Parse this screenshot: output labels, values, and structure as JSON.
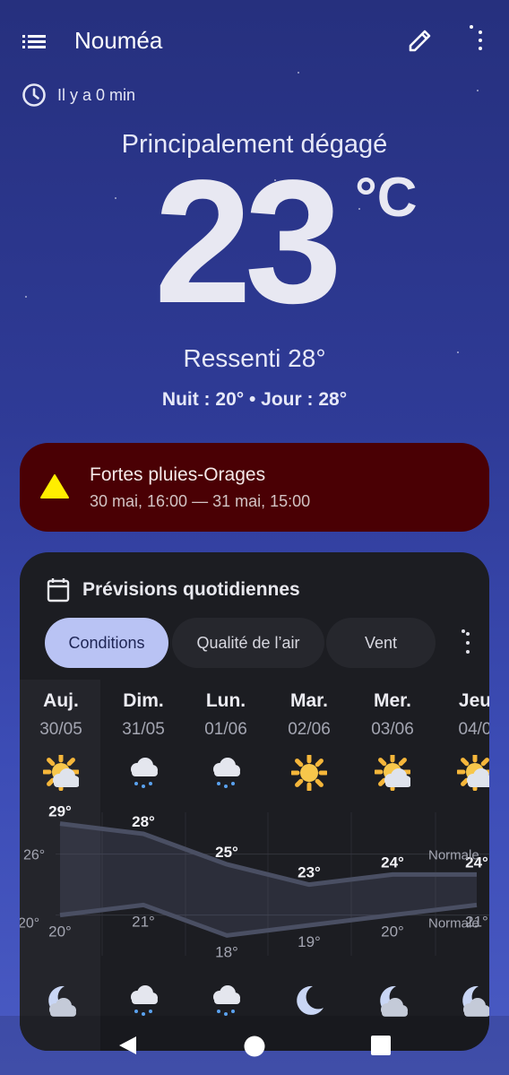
{
  "header": {
    "city": "Nouméa"
  },
  "updated": {
    "text": "Il y a 0 min"
  },
  "current": {
    "condition": "Principalement dégagé",
    "temperature": "23",
    "unit": "°C",
    "feels_like": "Ressenti 28°",
    "night_day": "Nuit : 20° • Jour : 28°"
  },
  "alert": {
    "title": "Fortes pluies-Orages",
    "period": "30 mai, 16:00 — 31 mai, 15:00",
    "background": "#4a0004",
    "icon_color": "#ffee00"
  },
  "forecast": {
    "title": "Prévisions quotidiennes",
    "tabs": [
      {
        "label": "Conditions",
        "active": true
      },
      {
        "label": "Qualité de l’air",
        "active": false
      },
      {
        "label": "Vent",
        "active": false
      }
    ],
    "days": [
      {
        "name": "Auj.",
        "date": "30/05",
        "day_icon": "sun-cloud-icon",
        "night_icon": "moon-cloud-icon",
        "high": 29,
        "low": 20,
        "high_label": "29°",
        "low_label": "20°"
      },
      {
        "name": "Dim.",
        "date": "31/05",
        "day_icon": "rain-icon",
        "night_icon": "rain-icon",
        "high": 28,
        "low": 21,
        "high_label": "28°",
        "low_label": "21°"
      },
      {
        "name": "Lun.",
        "date": "01/06",
        "day_icon": "rain-icon",
        "night_icon": "rain-icon",
        "high": 25,
        "low": 18,
        "high_label": "25°",
        "low_label": "18°"
      },
      {
        "name": "Mar.",
        "date": "02/06",
        "day_icon": "sun-icon",
        "night_icon": "moon-icon",
        "high": 23,
        "low": 19,
        "high_label": "23°",
        "low_label": "19°"
      },
      {
        "name": "Mer.",
        "date": "03/06",
        "day_icon": "sun-cloud-icon",
        "night_icon": "moon-cloud-icon",
        "high": 24,
        "low": 20,
        "high_label": "24°",
        "low_label": "20°"
      },
      {
        "name": "Jeu",
        "date": "04/0",
        "day_icon": "sun-cloud-icon",
        "night_icon": "moon-cloud-icon",
        "high": 24,
        "low": 21,
        "high_label": "24°",
        "low_label": "21°"
      }
    ],
    "normals": {
      "high": 26,
      "low": 20,
      "high_label": "26°",
      "low_label": "20°",
      "label": "Normale"
    }
  },
  "nav": {
    "back": "back-icon",
    "home": "home-icon",
    "recents": "recents-icon"
  }
}
